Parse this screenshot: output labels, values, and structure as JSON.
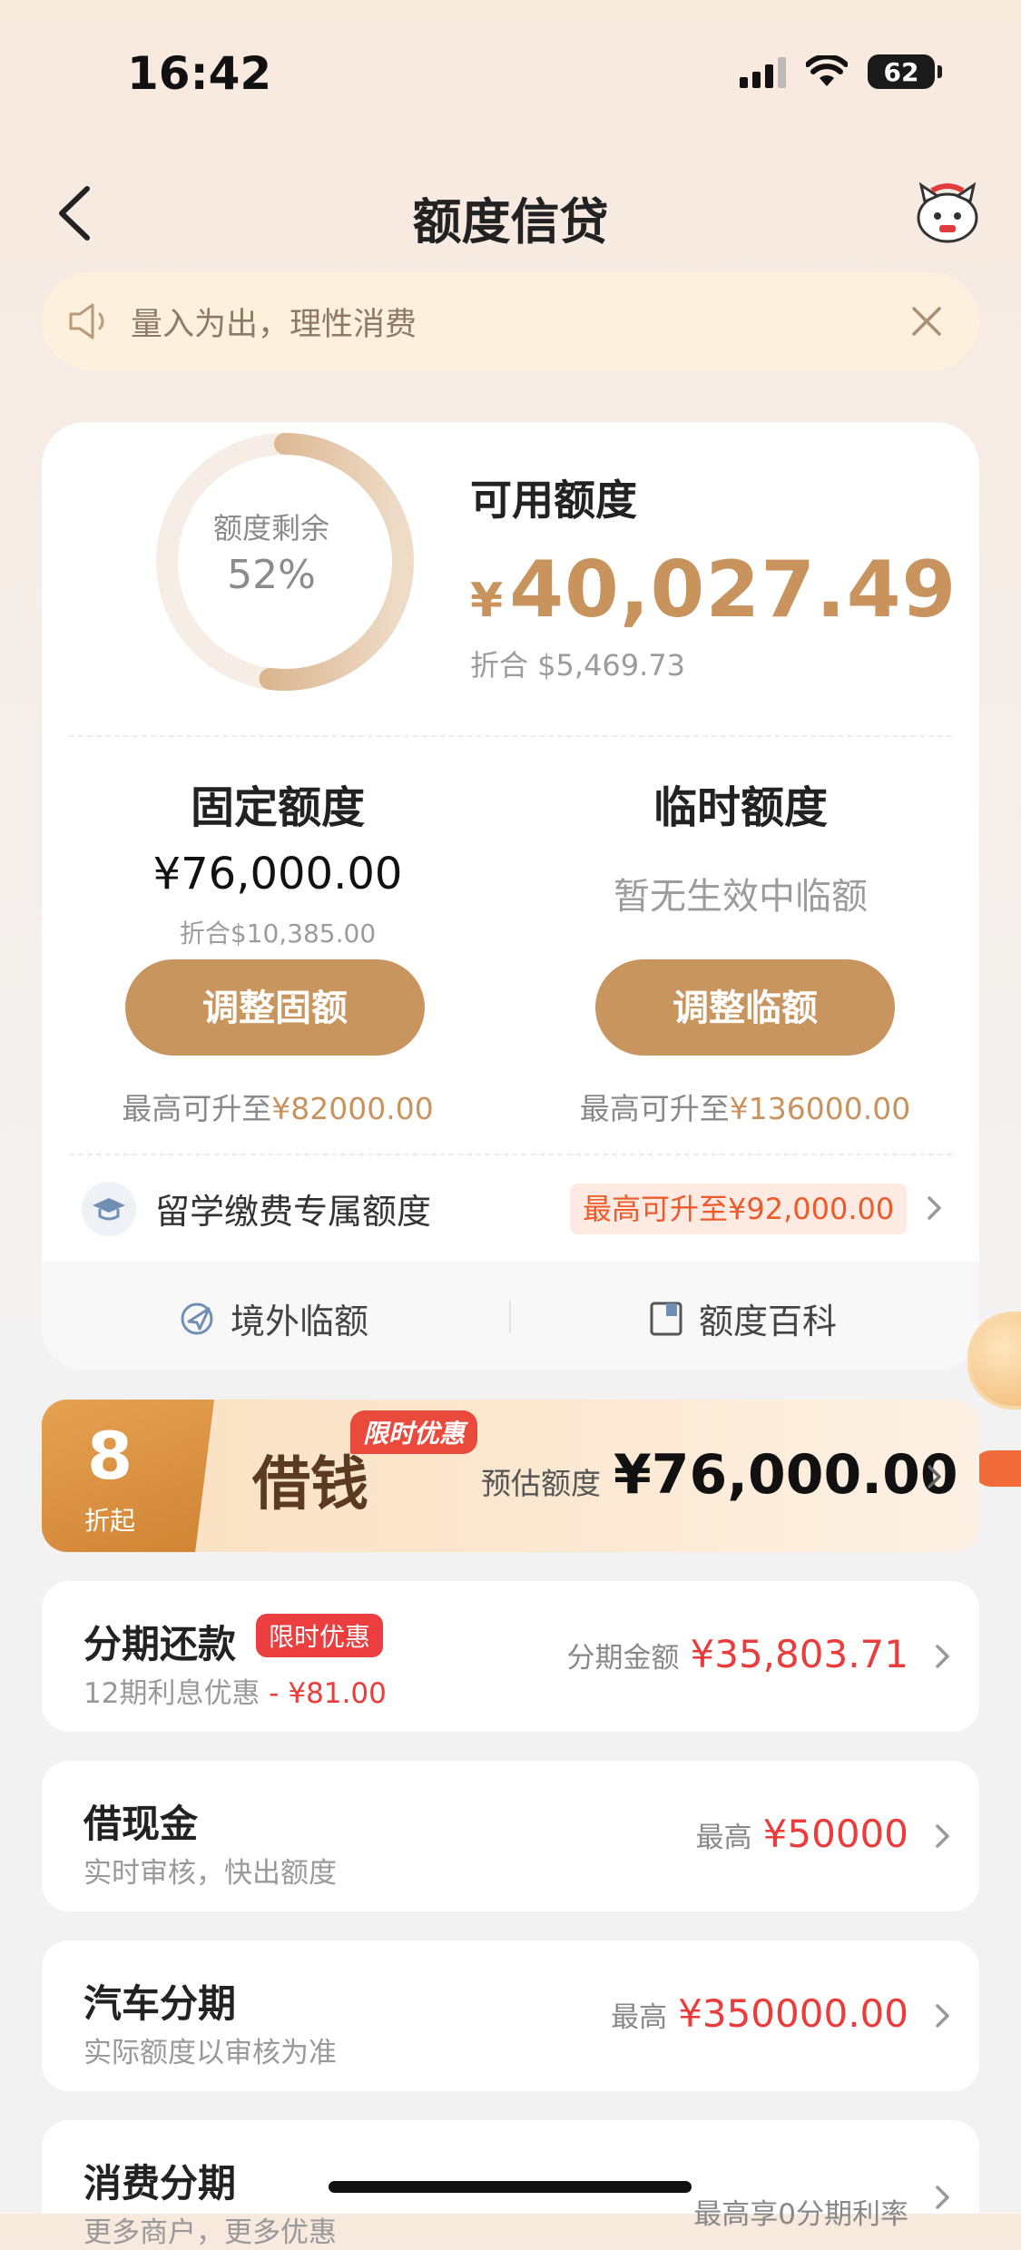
{
  "status_bar": {
    "time": "16:42",
    "battery": "62"
  },
  "header": {
    "title": "额度信贷",
    "back_icon": "chevron-left-icon",
    "mascot_icon": "mascot-icon"
  },
  "notice": {
    "text": "量入为出，理性消费"
  },
  "credit": {
    "remaining_label": "额度剩余",
    "remaining_pct": "52%",
    "remaining_fraction": 0.52,
    "available_label": "可用额度",
    "available_currency": "¥",
    "available_amount": "40,027.49",
    "available_converted": "折合  $5,469.73",
    "fixed": {
      "title": "固定额度",
      "amount": "¥76,000.00",
      "converted": "折合$10,385.00",
      "button": "调整固额",
      "max_prefix": "最高可升至",
      "max_value": "¥82000.00"
    },
    "temp": {
      "title": "临时额度",
      "status": "暂无生效中临额",
      "button": "调整临额",
      "max_prefix": "最高可升至",
      "max_value": "¥136000.00"
    },
    "study": {
      "label": "留学缴费专属额度",
      "badge": "最高可升至¥92,000.00"
    },
    "links": {
      "overseas": "境外临额",
      "wiki": "额度百科"
    }
  },
  "loan_banner": {
    "discount_num": "8",
    "discount_unit": "折起",
    "title": "借钱",
    "tag": "限时优惠",
    "estimate_label": "预估额度",
    "estimate_amount": "¥76,000.00"
  },
  "rows": [
    {
      "title": "分期还款",
      "tag": "限时优惠",
      "sub": "12期利息优惠",
      "sub_red": " - ¥81.00",
      "right_label": "分期金额",
      "right_value": "¥35,803.71"
    },
    {
      "title": "借现金",
      "sub": "实时审核，快出额度",
      "right_label": "最高",
      "right_value": "¥50000"
    },
    {
      "title": "汽车分期",
      "sub": "实际额度以审核为准",
      "right_label": "最高",
      "right_value": "¥350000.00"
    },
    {
      "title": "消费分期",
      "sub": "更多商户，更多优惠",
      "right_label": "最高享0分期利率"
    }
  ],
  "colors": {
    "gold": "#c9955f",
    "red": "#ec3b3b",
    "bg": "#f3f2f2"
  }
}
